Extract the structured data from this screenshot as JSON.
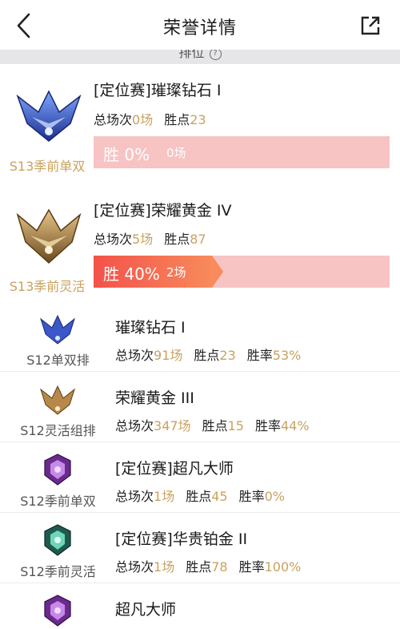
{
  "header": {
    "title": "荣誉详情"
  },
  "subbar": {
    "label": "排位",
    "info": "?"
  },
  "labels": {
    "total": "总场次",
    "points": "胜点",
    "rate": "胜率"
  },
  "seasons": [
    {
      "title": "[定位赛]璀璨钻石 I",
      "total": "0场",
      "points": "23",
      "sublabel": "S13季前单双",
      "win_text": "胜 0%",
      "games_text": "0场",
      "win_rate": 0
    },
    {
      "title": "[定位赛]荣耀黄金 IV",
      "total": "5场",
      "points": "87",
      "sublabel": "S13季前灵活",
      "win_text": "胜 40%",
      "games_text": "2场",
      "win_rate": 0.4
    }
  ],
  "rows": [
    {
      "title": "璀璨钻石 I",
      "sublabel": "S12单双排",
      "total": "91场",
      "points": "23",
      "rate": "53%",
      "emblem": "diamond-emblem-icon"
    },
    {
      "title": "荣耀黄金 III",
      "sublabel": "S12灵活组排",
      "total": "347场",
      "points": "15",
      "rate": "44%",
      "emblem": "gold-emblem-icon"
    },
    {
      "title": "[定位赛]超凡大师",
      "sublabel": "S12季前单双",
      "total": "1场",
      "points": "45",
      "rate": "0%",
      "emblem": "master-emblem-icon"
    },
    {
      "title": "[定位赛]华贵铂金 II",
      "sublabel": "S12季前灵活",
      "total": "1场",
      "points": "78",
      "rate": "100%",
      "emblem": "platinum-emblem-icon"
    },
    {
      "title": "超凡大师",
      "sublabel": "",
      "total": "",
      "points": "",
      "rate": "",
      "emblem": "master-emblem-icon"
    }
  ]
}
